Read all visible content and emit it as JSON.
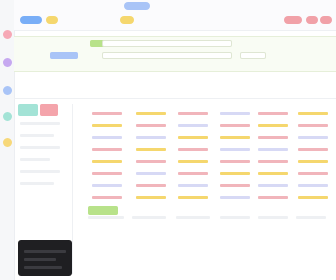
{
  "colors": {
    "rail": [
      "#f6a8b6",
      "#c6a8f0",
      "#a9c4f7",
      "#a3e3d6",
      "#f7d87a"
    ],
    "accent_blue": "#79aef7",
    "accent_yellow": "#f5d76e",
    "accent_red": "#f1a1a8",
    "accent_green": "#b8e28a",
    "legend_red": "#f4a4ab",
    "dark": "#1f1f22"
  },
  "rail": {
    "items": [
      {
        "icon": "home-icon"
      },
      {
        "icon": "calendar-icon"
      },
      {
        "icon": "chart-icon"
      },
      {
        "icon": "list-icon"
      },
      {
        "icon": "bell-icon"
      }
    ]
  },
  "topbar": {
    "tabs": [
      {
        "color": "#79aef7"
      },
      {
        "color": "#f5d76e"
      },
      {
        "color": "#a9c4f7"
      },
      {
        "color": "#f5d76e"
      }
    ],
    "right_buttons": [
      {
        "color": "#f1a1a8"
      },
      {
        "color": "#f1a1a8"
      },
      {
        "color": "#f1a1a8"
      }
    ]
  },
  "filter": {
    "chips": [
      {
        "color": "#b8e28a"
      },
      {
        "color": "#a9c4f7"
      },
      {
        "color": "#f1a1a8"
      }
    ]
  },
  "columns": [
    {
      "pattern": [
        "#f1b5bb",
        "#f5d76e",
        "#d7d9f5",
        "#f1b5bb",
        "#f5d76e",
        "#f1b5bb",
        "#d7d9f5",
        "#f1b5bb"
      ]
    },
    {
      "pattern": [
        "#f5d76e",
        "#f1b5bb",
        "#d7d9f5",
        "#f5d76e",
        "#f1b5bb",
        "#d7d9f5",
        "#f1b5bb",
        "#f5d76e"
      ]
    },
    {
      "pattern": [
        "#f1b5bb",
        "#d7d9f5",
        "#f5d76e",
        "#f1b5bb",
        "#f5d76e",
        "#f1b5bb",
        "#d7d9f5",
        "#f5d76e"
      ]
    },
    {
      "pattern": [
        "#d7d9f5",
        "#f1b5bb",
        "#f5d76e",
        "#d7d9f5",
        "#f1b5bb",
        "#f5d76e",
        "#f1b5bb",
        "#d7d9f5"
      ]
    },
    {
      "pattern": [
        "#f1b5bb",
        "#f5d76e",
        "#f1b5bb",
        "#d7d9f5",
        "#f1b5bb",
        "#f5d76e",
        "#d7d9f5",
        "#f1b5bb"
      ]
    },
    {
      "pattern": [
        "#f5d76e",
        "#f1b5bb",
        "#d7d9f5",
        "#f1b5bb",
        "#f5d76e",
        "#f1b5bb",
        "#d7d9f5",
        "#f5d76e"
      ]
    }
  ]
}
